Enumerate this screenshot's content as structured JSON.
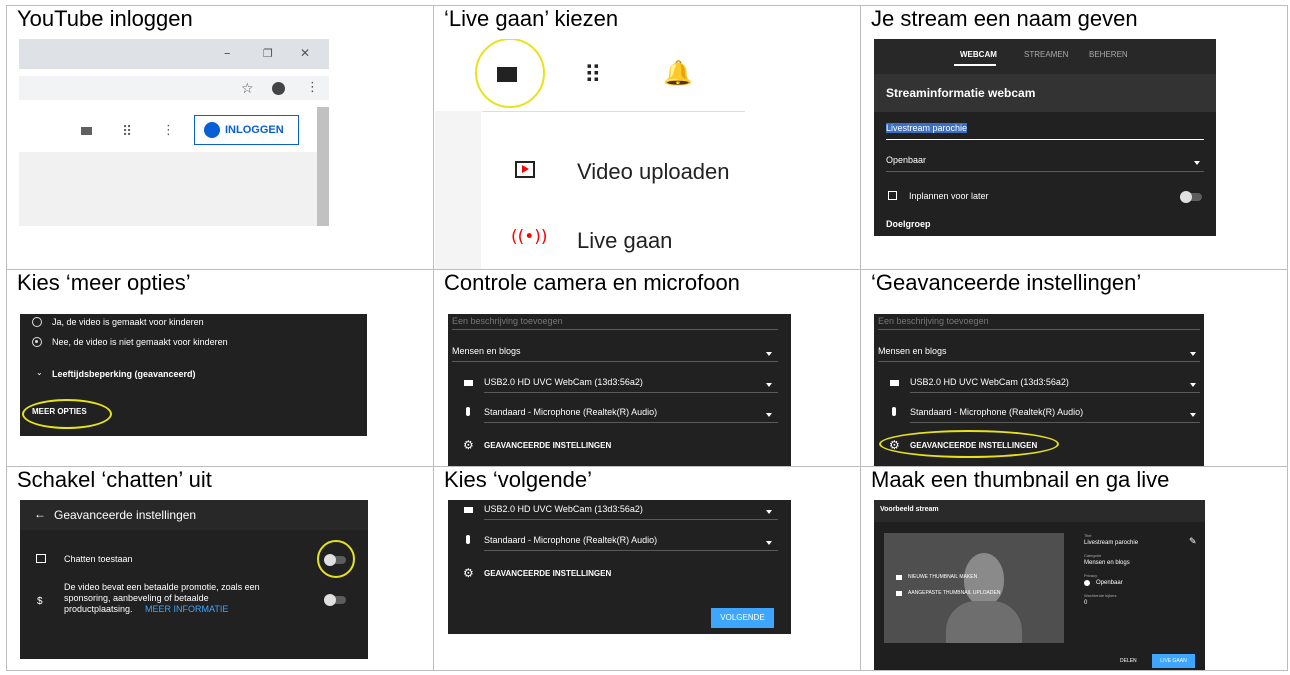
{
  "cells": [
    {
      "title": "YouTube inloggen"
    },
    {
      "title": "‘Live gaan’ kiezen"
    },
    {
      "title": "Je stream een naam geven"
    },
    {
      "title": "Kies ‘meer opties’"
    },
    {
      "title": "Controle camera en microfoon"
    },
    {
      "title": "‘Geavanceerde instellingen’"
    },
    {
      "title": "Schakel ‘chatten’ uit"
    },
    {
      "title": "Kies ‘volgende’"
    },
    {
      "title": "Maak een thumbnail en ga live"
    }
  ],
  "s1": {
    "login_label": "INLOGGEN",
    "minimize": "–",
    "restore": "❐",
    "close": "✕",
    "star": "☆",
    "more": "⋮"
  },
  "s2": {
    "upload_label": "Video uploaden",
    "live_label": "Live gaan"
  },
  "s3": {
    "tabs": [
      "WEBCAM",
      "STREAMEN",
      "BEHEREN"
    ],
    "header": "Streaminformatie webcam",
    "title_value": "Livestream parochie",
    "visibility": "Openbaar",
    "schedule": "Inplannen voor later",
    "audience": "Doelgroep"
  },
  "s4": {
    "yes_kids": "Ja, de video is gemaakt voor kinderen",
    "no_kids": "Nee, de video is niet gemaakt voor kinderen",
    "age": "Leeftijdsbeperking (geavanceerd)",
    "more": "MEER OPTIES"
  },
  "s5": {
    "description_placeholder": "Een beschrijving toevoegen",
    "category": "Mensen en blogs",
    "camera": "USB2.0 HD UVC WebCam (13d3:56a2)",
    "microphone": "Standaard - Microphone (Realtek(R) Audio)",
    "advanced": "GEAVANCEERDE INSTELLINGEN"
  },
  "s6": {
    "description_placeholder": "Een beschrijving toevoegen",
    "category": "Mensen en blogs",
    "camera": "USB2.0 HD UVC WebCam (13d3:56a2)",
    "microphone": "Standaard - Microphone (Realtek(R) Audio)",
    "advanced": "GEAVANCEERDE INSTELLINGEN"
  },
  "s7": {
    "header": "Geavanceerde instellingen",
    "chat": "Chatten toestaan",
    "promo_1": "De video bevat een betaalde promotie, zoals een",
    "promo_2": "sponsoring, aanbeveling of betaalde",
    "promo_3": "productplaatsing.",
    "promo_link": "MEER INFORMATIE"
  },
  "s8": {
    "camera": "USB2.0 HD UVC WebCam (13d3:56a2)",
    "microphone": "Standaard - Microphone (Realtek(R) Audio)",
    "advanced": "GEAVANCEERDE INSTELLINGEN",
    "next": "VOLGENDE"
  },
  "s9": {
    "header": "Voorbeeld stream",
    "new_thumb": "NIEUWE THUMBNAIL MAKEN",
    "upload_thumb": "AANGEPASTE THUMBNAIL UPLOADEN",
    "title_label": "Titel",
    "title_value": "Livestream parochie",
    "category_label": "Categorie",
    "category_value": "Mensen en blogs",
    "privacy_label": "Privacy",
    "privacy_value": "Openbaar",
    "viewers_label": "Wachtende kijkers",
    "viewers_value": "0",
    "share": "DELEN",
    "live": "LIVE GAAN"
  },
  "colors": {
    "yellow_ring": "#e8e21a",
    "yt_red": "#ff0000",
    "blue": "#3ea6ff",
    "login_blue": "#065fd4"
  }
}
